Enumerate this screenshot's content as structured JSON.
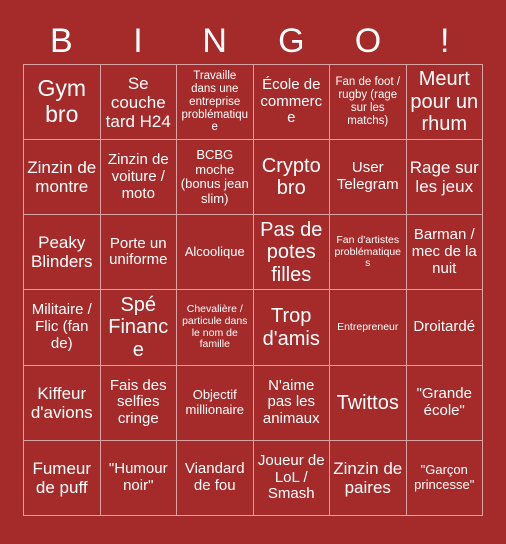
{
  "header": {
    "letters": [
      "B",
      "I",
      "N",
      "G",
      "O",
      "!"
    ]
  },
  "colors": {
    "background": "#a52a2a",
    "cell_background": "#a52a2a",
    "grid_line": "#d9a3a3",
    "text": "#ffffff"
  },
  "grid": {
    "columns": 6,
    "rows": 6,
    "cells": [
      {
        "text": "Gym bro",
        "size": "fs-xxl"
      },
      {
        "text": "Se couche tard H24",
        "size": "fs-l"
      },
      {
        "text": "Travaille dans une entreprise problématique",
        "size": "fs-xs"
      },
      {
        "text": "École de commerce",
        "size": "fs-m"
      },
      {
        "text": "Fan de foot / rugby (rage sur les matchs)",
        "size": "fs-xs"
      },
      {
        "text": "Meurt pour un rhum",
        "size": "fs-xl"
      },
      {
        "text": "Zinzin de montre",
        "size": "fs-l"
      },
      {
        "text": "Zinzin de voiture / moto",
        "size": "fs-m"
      },
      {
        "text": "BCBG moche (bonus jean slim)",
        "size": "fs-s"
      },
      {
        "text": "Crypto bro",
        "size": "fs-xl"
      },
      {
        "text": "User Telegram",
        "size": "fs-m"
      },
      {
        "text": "Rage sur les jeux",
        "size": "fs-l"
      },
      {
        "text": "Peaky Blinders",
        "size": "fs-l"
      },
      {
        "text": "Porte un uniforme",
        "size": "fs-m"
      },
      {
        "text": "Alcoolique",
        "size": "fs-s"
      },
      {
        "text": "Pas de potes filles",
        "size": "fs-xl"
      },
      {
        "text": "Fan d'artistes problématiques",
        "size": "fs-xxs"
      },
      {
        "text": "Barman / mec de la nuit",
        "size": "fs-m"
      },
      {
        "text": "Militaire / Flic (fan de)",
        "size": "fs-m"
      },
      {
        "text": "Spé Finance",
        "size": "fs-xl"
      },
      {
        "text": "Chevalière / particule dans le nom de famille",
        "size": "fs-xxs"
      },
      {
        "text": "Trop d'amis",
        "size": "fs-xl"
      },
      {
        "text": "Entrepreneur",
        "size": "fs-xxs"
      },
      {
        "text": "Droitardé",
        "size": "fs-m"
      },
      {
        "text": "Kiffeur d'avions",
        "size": "fs-l"
      },
      {
        "text": "Fais des selfies cringe",
        "size": "fs-m"
      },
      {
        "text": "Objectif millionaire",
        "size": "fs-s"
      },
      {
        "text": "N'aime pas les animaux",
        "size": "fs-m"
      },
      {
        "text": "Twittos",
        "size": "fs-xl"
      },
      {
        "text": "\"Grande école\"",
        "size": "fs-m"
      },
      {
        "text": "Fumeur de puff",
        "size": "fs-l"
      },
      {
        "text": "\"Humour noir\"",
        "size": "fs-m"
      },
      {
        "text": "Viandard de fou",
        "size": "fs-m"
      },
      {
        "text": "Joueur de LoL / Smash",
        "size": "fs-m"
      },
      {
        "text": "Zinzin de paires",
        "size": "fs-l"
      },
      {
        "text": "\"Garçon princesse\"",
        "size": "fs-s"
      }
    ]
  }
}
